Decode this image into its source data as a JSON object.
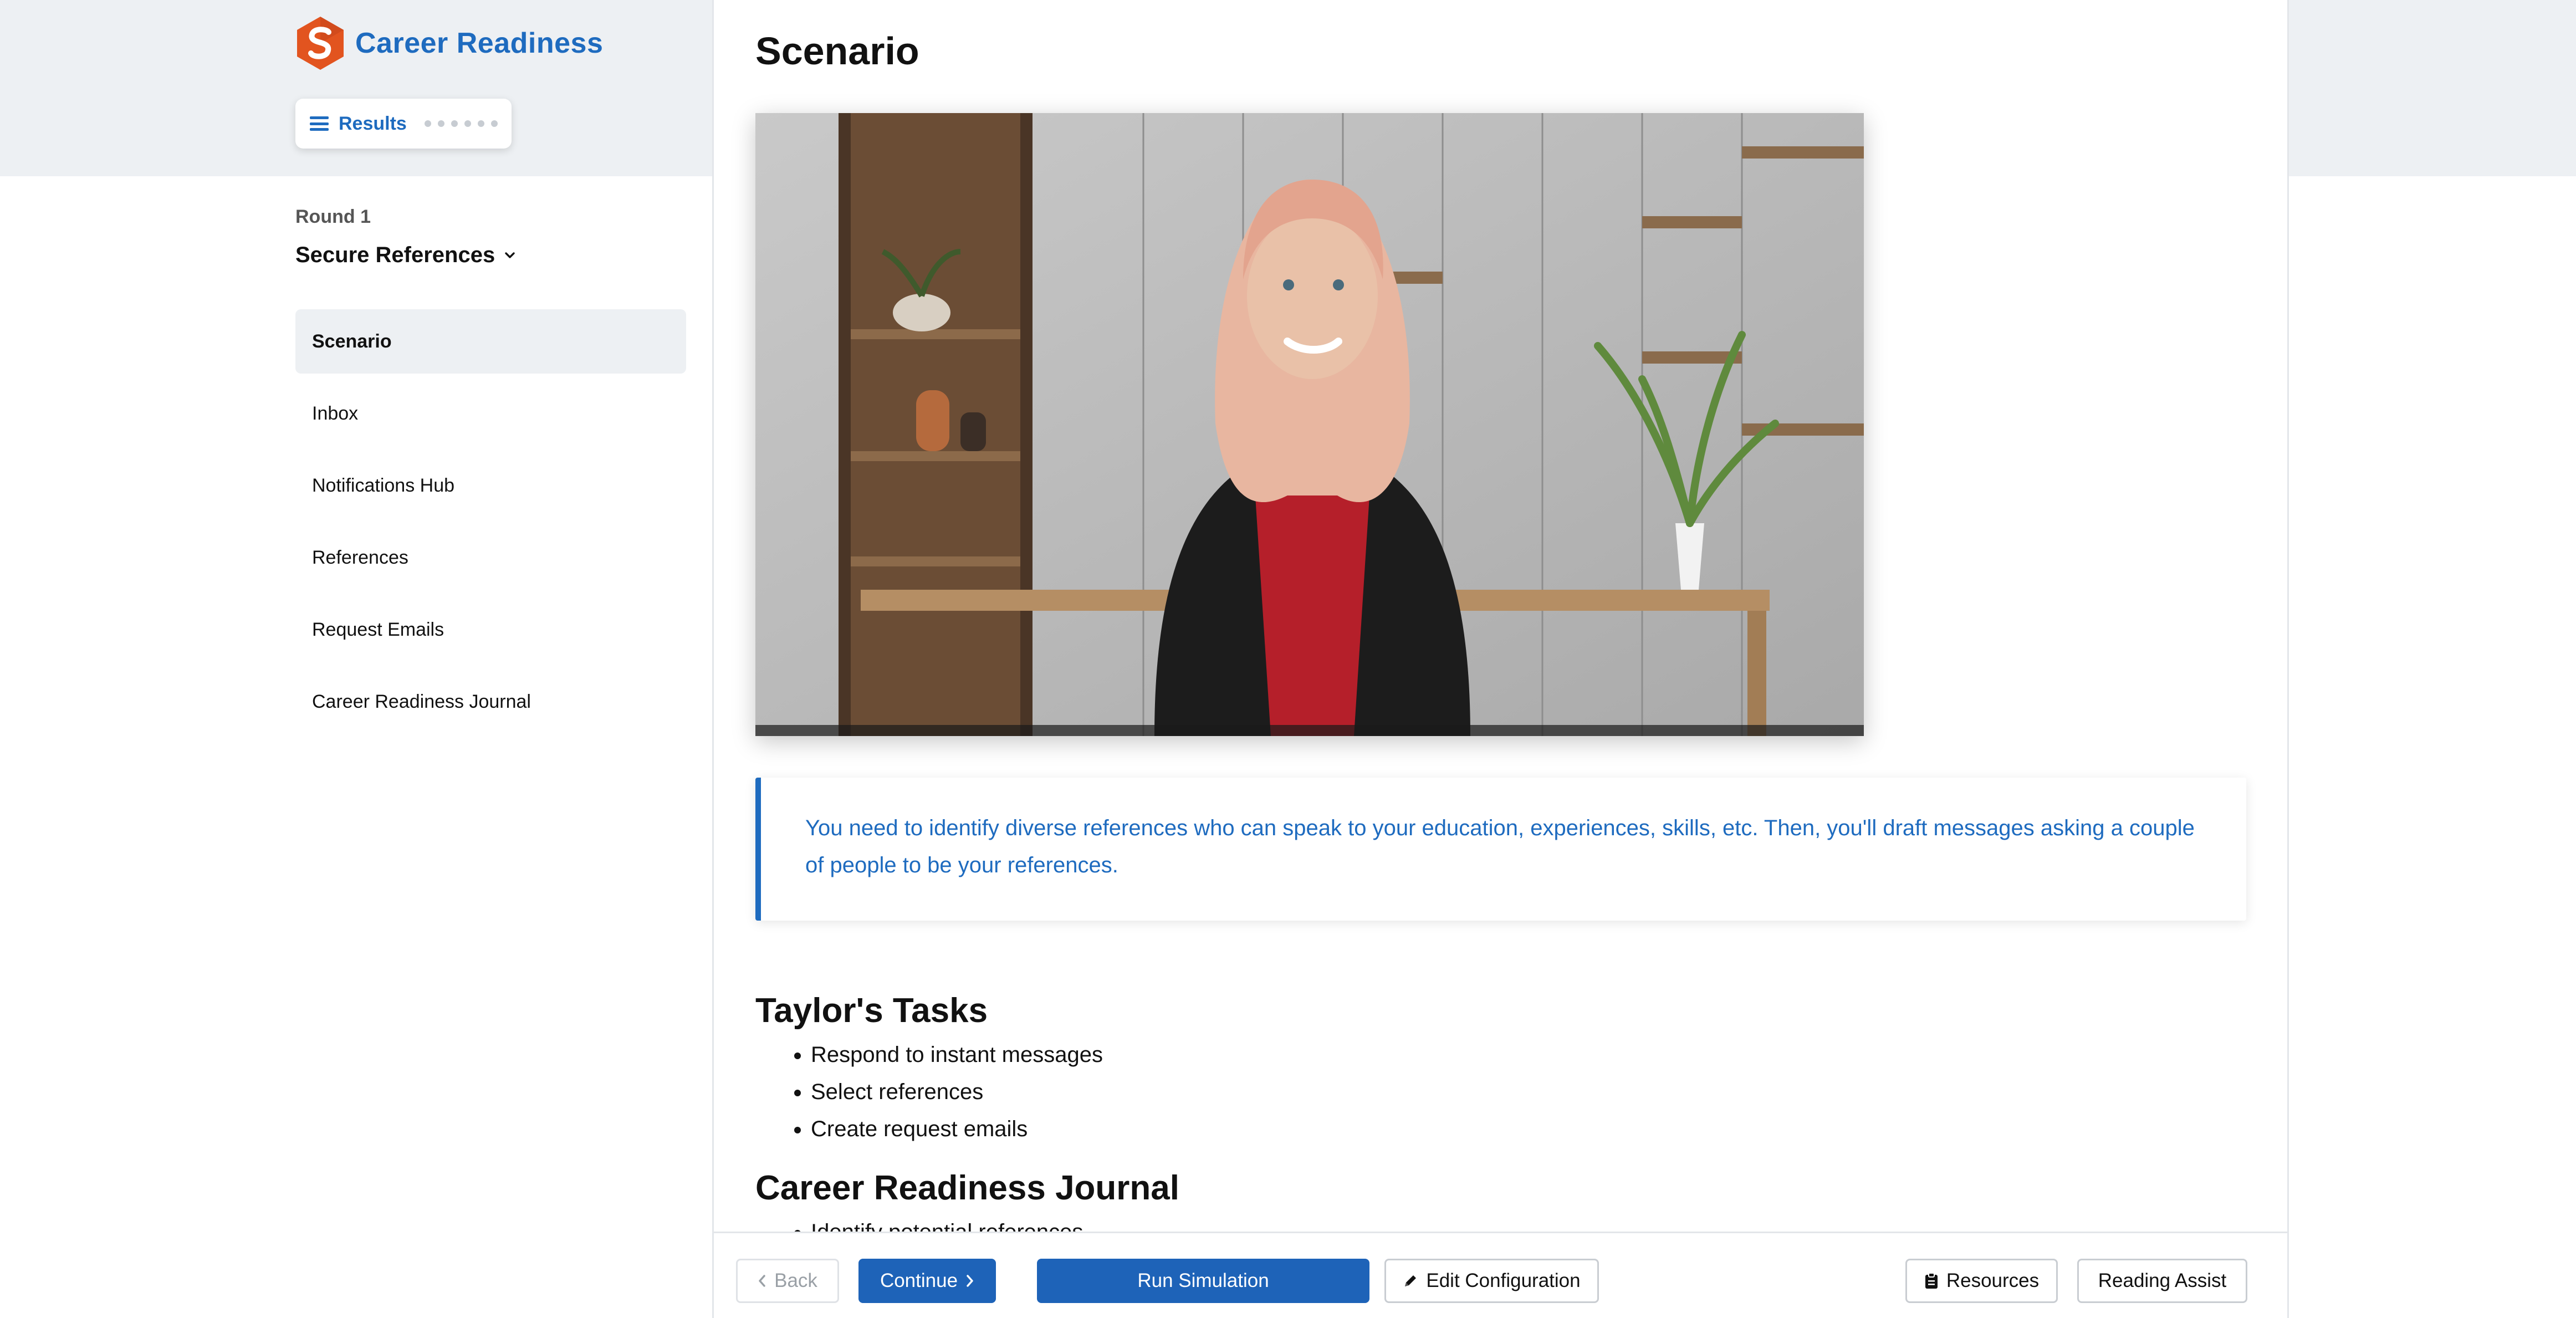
{
  "app": {
    "title": "Career Readiness"
  },
  "header": {
    "results_label": "Results"
  },
  "sidebar": {
    "round_label": "Round 1",
    "module_title": "Secure References",
    "items": [
      {
        "label": "Scenario",
        "active": true
      },
      {
        "label": "Inbox"
      },
      {
        "label": "Notifications Hub"
      },
      {
        "label": "References"
      },
      {
        "label": "Request Emails"
      },
      {
        "label": "Career Readiness Journal"
      }
    ]
  },
  "main": {
    "page_title": "Scenario",
    "video_alt": "Presenter video",
    "callout_text": "You need to identify diverse references who can speak to your education, experiences, skills, etc. Then, you'll draft messages asking a couple of people to be your references.",
    "tasks_heading": "Taylor's Tasks",
    "tasks": [
      "Respond to instant messages",
      "Select references",
      "Create request emails"
    ],
    "journal_heading": "Career Readiness Journal",
    "journal_items": [
      "Identify potential references"
    ]
  },
  "footer": {
    "back_label": "Back",
    "continue_label": "Continue",
    "run_label": "Run Simulation",
    "edit_label": "Edit Configuration",
    "resources_label": "Resources",
    "reading_label": "Reading Assist"
  },
  "colors": {
    "brand": "#1e6bbf",
    "primary_button": "#1e63b8",
    "logo_orange": "#e2541f",
    "band": "#edf0f3"
  }
}
